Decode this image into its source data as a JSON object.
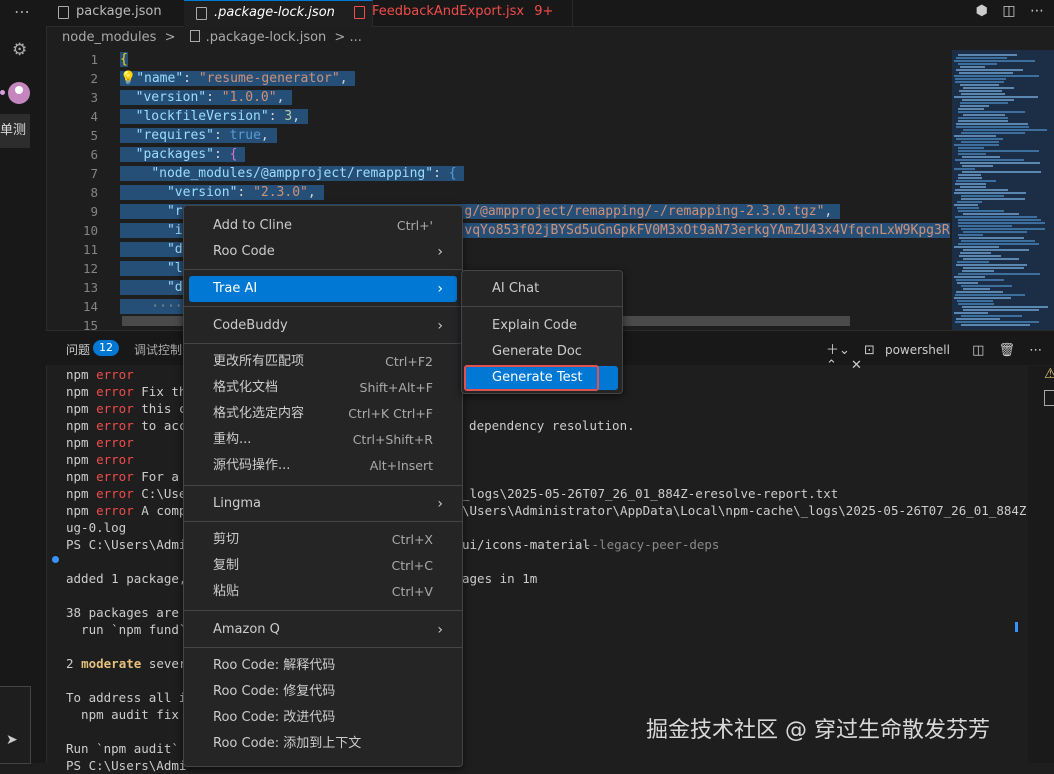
{
  "tabs": [
    {
      "label": "package.json"
    },
    {
      "label": ".package-lock.json"
    },
    {
      "label": "FeedbackAndExport.jsx",
      "badge": "9+"
    }
  ],
  "breadcrumb": {
    "folder": "node_modules",
    "sep": ">",
    "file": ".package-lock.json",
    "tail": "> ..."
  },
  "activity": {
    "side_text": "单测"
  },
  "editor": {
    "line_numbers": [
      "1",
      "2",
      "3",
      "4",
      "5",
      "6",
      "7",
      "8",
      "9",
      "10",
      "11",
      "12",
      "13",
      "14",
      "15"
    ],
    "lines": {
      "l1": "{",
      "l2_key": "\"name\"",
      "l2_val": "\"resume-generator\"",
      "l3_key": "\"version\"",
      "l3_val": "\"1.0.0\"",
      "l4_key": "\"lockfileVersion\"",
      "l4_val": "3",
      "l5_key": "\"requires\"",
      "l5_val": "true",
      "l6_key": "\"packages\"",
      "l7_key": "\"node_modules/@ampproject/remapping\"",
      "l8_key": "\"version\"",
      "l8_val": "\"2.3.0\"",
      "l9_a": "\"r",
      "l9_b": "g/@ampproject/remapping/-/remapping-2.3.0.tgz\"",
      "l10_a": "\"i",
      "l10_b": "vqYo853f02jBYSd5uGnGpkFV0M3xOt9aN73erkgYAmZU43x4VfqcnLxW9Kpg3R5",
      "l11_a": "\"d",
      "l12_a": "\"l",
      "l13_a": "\"d"
    }
  },
  "panel": {
    "problems_label": "问题",
    "problems_count": "12",
    "debug_label": "调试控制台",
    "shell": "powershell"
  },
  "terminal": {
    "l1": "npm",
    "l1e": "error",
    "l2e": "error",
    "l2t": "Fix the",
    "l3e": "error",
    "l3t": "this co",
    "l3r": "s",
    "l4e": "error",
    "l4t": "to acce",
    "l4r": ") dependency resolution.",
    "l5e": "error",
    "l6e": "error",
    "l7e": "error",
    "l7t": "For a f",
    "l8e": "error",
    "l8t": "C:\\User",
    "l8r": "_logs\\2025-05-26T07_26_01_884Z-eresolve-report.txt",
    "l9e": "error",
    "l9t": "A compl",
    "l9r": "\\Users\\Administrator\\AppData\\Local\\npm-cache\\_logs\\2025-05-26T07_26_01_884Z-deb",
    "l10": "ug-0.log",
    "l11": "PS C:\\Users\\Admi",
    "l11r": "ui/icons-material",
    "l11r2": "--legacy-peer-deps",
    "l12": "added 1 package,",
    "l12r": "ages in 1m",
    "l13": "38 packages are l",
    "l14": "  run `npm fund`",
    "l15a": "2",
    "l15b": "moderate",
    "l15c": "severi",
    "l16": "To address all is",
    "l17": "  npm audit fix -",
    "l18": "Run `npm audit` f",
    "l19": "PS C:\\Users\\Admi"
  },
  "context_menu": {
    "items": [
      {
        "label": "Add to Cline",
        "shortcut": "Ctrl+'"
      },
      {
        "label": "Roo Code",
        "submenu": true
      },
      {
        "label": "Trae AI",
        "submenu": true,
        "highlighted": true
      },
      {
        "label": "CodeBuddy",
        "submenu": true
      },
      {
        "label": "更改所有匹配项",
        "shortcut": "Ctrl+F2"
      },
      {
        "label": "格式化文档",
        "shortcut": "Shift+Alt+F"
      },
      {
        "label": "格式化选定内容",
        "shortcut": "Ctrl+K Ctrl+F"
      },
      {
        "label": "重构...",
        "shortcut": "Ctrl+Shift+R"
      },
      {
        "label": "源代码操作...",
        "shortcut": "Alt+Insert"
      },
      {
        "label": "Lingma",
        "submenu": true
      },
      {
        "label": "剪切",
        "shortcut": "Ctrl+X"
      },
      {
        "label": "复制",
        "shortcut": "Ctrl+C"
      },
      {
        "label": "粘贴",
        "shortcut": "Ctrl+V"
      },
      {
        "label": "Amazon Q",
        "submenu": true
      },
      {
        "label": "Roo Code: 解释代码"
      },
      {
        "label": "Roo Code: 修复代码"
      },
      {
        "label": "Roo Code: 改进代码"
      },
      {
        "label": "Roo Code: 添加到上下文"
      }
    ],
    "arrow": "›"
  },
  "submenu_trae": {
    "items": [
      {
        "label": "AI Chat"
      },
      {
        "label": "Explain Code"
      },
      {
        "label": "Generate Doc"
      },
      {
        "label": "Generate Test",
        "selected": true
      }
    ]
  },
  "watermark": "掘金技术社区 @ 穿过生命散发芬芳",
  "colors": {
    "accent": "#0078d4",
    "error": "#f14c4c",
    "highlight_box": "#e05252"
  }
}
